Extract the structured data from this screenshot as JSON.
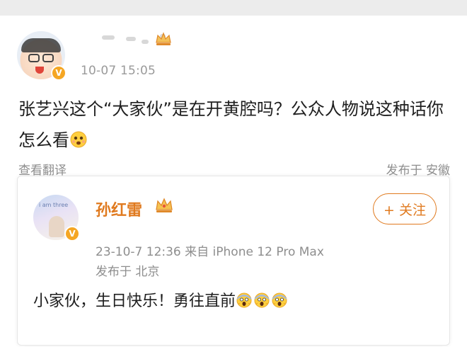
{
  "post": {
    "author_name": "",
    "timestamp": "10-07 15:05",
    "text": "张艺兴这个“大家伙”是在开黄腔吗？公众人物说这种话你怎么看",
    "emoji_icon": "thinking-face-icon",
    "translate_label": "查看翻译",
    "location": "发布于 安徽"
  },
  "quoted": {
    "author_name": "孙红雷",
    "follow_label": "+ 关注",
    "meta_line": "23-10-7 12:36   来自 iPhone 12 Pro Max",
    "location": "发布于 北京",
    "text": "小家伙，生日快乐！勇往直前",
    "emoji_icons": [
      "screaming-face-icon",
      "screaming-face-icon",
      "screaming-face-icon"
    ],
    "avatar_text": "i am three"
  },
  "colors": {
    "accent": "#e07a1f",
    "verified": "#f5a623",
    "meta": "#8e8e8e"
  }
}
